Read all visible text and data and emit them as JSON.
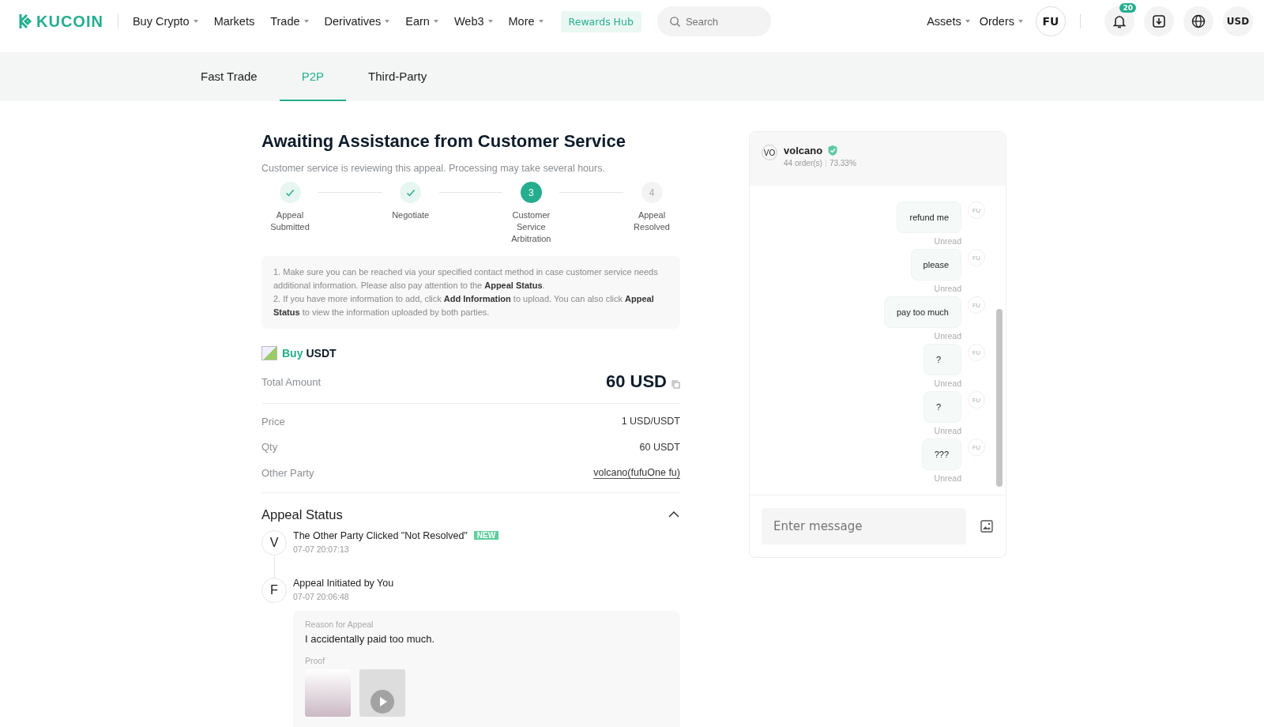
{
  "header": {
    "logo": "KUCOIN",
    "nav": [
      {
        "label": "Buy Crypto",
        "dropdown": true
      },
      {
        "label": "Markets",
        "dropdown": false
      },
      {
        "label": "Trade",
        "dropdown": true
      },
      {
        "label": "Derivatives",
        "dropdown": true
      },
      {
        "label": "Earn",
        "dropdown": true
      },
      {
        "label": "Web3",
        "dropdown": true
      },
      {
        "label": "More",
        "dropdown": true
      }
    ],
    "rewards": "Rewards Hub",
    "search": {
      "placeholder": "Search"
    },
    "right": [
      {
        "label": "Assets",
        "dropdown": true
      },
      {
        "label": "Orders",
        "dropdown": true
      }
    ],
    "avatar": "FU",
    "notifications": "20",
    "currency": "USD"
  },
  "tabs": [
    {
      "label": "Fast Trade",
      "selected": false
    },
    {
      "label": "P2P",
      "selected": true
    },
    {
      "label": "Third-Party",
      "selected": false
    }
  ],
  "title": "Awaiting Assistance from Customer Service",
  "subtitle": "Customer service is reviewing this appeal. Processing may take several hours.",
  "steps": [
    {
      "kind": "done",
      "label": "Appeal Submitted"
    },
    {
      "kind": "done",
      "label": "Negotiate"
    },
    {
      "kind": "current",
      "number": "3",
      "label": "Customer Service Arbitration"
    },
    {
      "kind": "pending",
      "number": "4",
      "label": "Appeal Resolved"
    }
  ],
  "notes": [
    "1. Make sure you can be reached via your specified contact method in case customer service needs additional information. Please also pay attention to the **Appeal Status**.",
    "2. If you have more information to add, click **Add Information** to upload. You can also click **Appeal Status** to view the information uploaded by both parties."
  ],
  "order": {
    "side": "Buy",
    "asset": "USDT",
    "total_label": "Total Amount",
    "total": "60 USD",
    "rows": [
      {
        "label": "Price",
        "value": "1 USD/USDT",
        "kind": "text"
      },
      {
        "label": "Qty",
        "value": "60 USDT",
        "kind": "text"
      },
      {
        "label": "Other Party",
        "value": "volcano(fufuOne fu)",
        "kind": "link"
      }
    ]
  },
  "appeal": {
    "title": "Appeal Status",
    "expanded": true,
    "events": [
      {
        "avatar": "V",
        "title": "The Other Party Clicked \"Not Resolved\"",
        "badge": "NEW",
        "time": "07-07 20:07:13"
      },
      {
        "avatar": "F",
        "title": "Appeal Initiated by You",
        "time": "07-07 20:06:48",
        "reason_label": "Reason for Appeal",
        "reason": "I accidentally paid too much.",
        "proof_label": "Proof"
      }
    ]
  },
  "chat": {
    "avatar": "VO",
    "name": "volcano",
    "verified": true,
    "orders": "44 order(s)",
    "rate": "73.33%",
    "messages": [
      {
        "text": "refund me",
        "avatar": "FU",
        "status": "Unread"
      },
      {
        "text": "please",
        "avatar": "FU",
        "status": "Unread"
      },
      {
        "text": "pay too much",
        "avatar": "FU",
        "status": "Unread"
      },
      {
        "text": "?",
        "avatar": "FU",
        "status": "Unread"
      },
      {
        "text": "?",
        "avatar": "FU",
        "status": "Unread"
      },
      {
        "text": "???",
        "avatar": "FU",
        "status": "Unread"
      }
    ],
    "input": {
      "placeholder": "Enter message"
    }
  }
}
